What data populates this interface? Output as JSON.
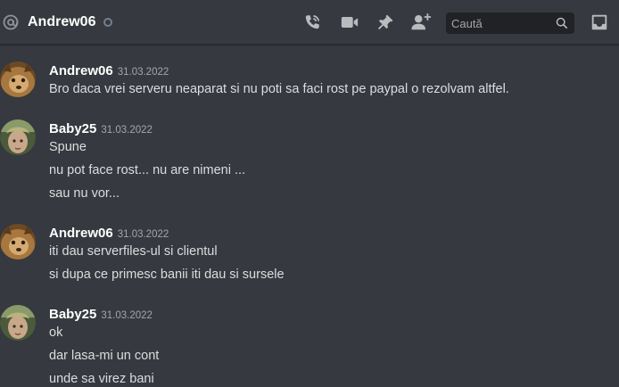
{
  "header": {
    "title": "Andrew06",
    "search_placeholder": "Caută",
    "icons": [
      "at-icon",
      "start-voice-call-icon",
      "start-video-call-icon",
      "pinned-messages-icon",
      "add-friends-to-dm-icon",
      "search-icon",
      "inbox-icon"
    ]
  },
  "colors": {
    "background": "#36393f",
    "search_background": "#202225",
    "author": "#ffffff",
    "text": "#dcddde",
    "timestamp": "#a3a6aa",
    "status_offline": "#747f8d",
    "icons": "#b9bbbe"
  },
  "messages": [
    {
      "author": "Andrew06",
      "timestamp": "31.03.2022",
      "lines": [
        "Bro daca vrei serveru neaparat si nu poti sa faci rost pe paypal o rezolvam altfel."
      ]
    },
    {
      "author": "Baby25",
      "timestamp": "31.03.2022",
      "lines": [
        "Spune",
        "nu pot face rost... nu are nimeni ...",
        "sau nu vor..."
      ]
    },
    {
      "author": "Andrew06",
      "timestamp": "31.03.2022",
      "lines": [
        "iti dau serverfiles-ul si clientul",
        "si dupa ce primesc banii iti dau si sursele"
      ]
    },
    {
      "author": "Baby25",
      "timestamp": "31.03.2022",
      "lines": [
        "ok",
        "dar lasa-mi un cont",
        "unde sa virez bani"
      ]
    }
  ]
}
